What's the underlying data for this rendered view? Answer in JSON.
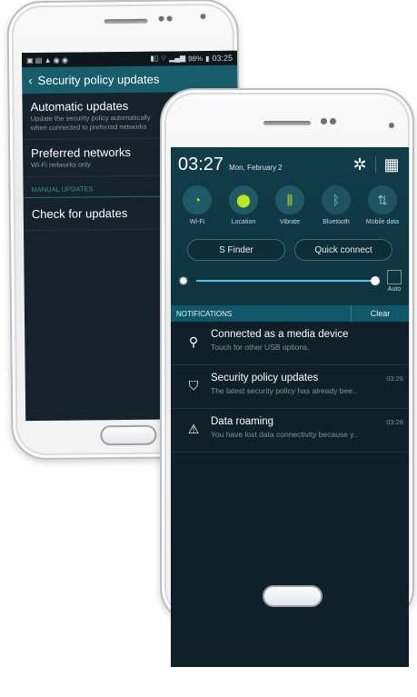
{
  "back_phone": {
    "status_bar": {
      "time": "03:25",
      "battery": "98%"
    },
    "action_bar": {
      "title": "Security policy updates"
    },
    "items": [
      {
        "title": "Automatic updates",
        "subtitle": "Update the security policy automatically",
        "subtitle2": "when connected to preferred networks"
      },
      {
        "title": "Preferred networks",
        "subtitle": "Wi-Fi networks only"
      }
    ],
    "section_header": "MANUAL UPDATES",
    "manual_item": {
      "title": "Check for updates"
    }
  },
  "front_phone": {
    "time": "03:27",
    "date": "Mon, February 2",
    "toggles": [
      {
        "label": "Wi-Fi",
        "icon": "wifi-icon",
        "on": true
      },
      {
        "label": "Location",
        "icon": "location-icon",
        "on": true
      },
      {
        "label": "Vibrate",
        "icon": "vibrate-icon",
        "on": true
      },
      {
        "label": "Bluetooth",
        "icon": "bluetooth-icon",
        "on": false
      },
      {
        "label": "Mobile data",
        "icon": "mobile-data-icon",
        "on": false
      }
    ],
    "buttons": {
      "s_finder": "S Finder",
      "quick_connect": "Quick connect"
    },
    "brightness": {
      "auto_label": "Auto",
      "level": 0.85
    },
    "notifications_header": "NOTIFICATIONS",
    "clear_label": "Clear",
    "notifications": [
      {
        "icon": "usb-icon",
        "title": "Connected as a media device",
        "text": "Touch for other USB options.",
        "time": ""
      },
      {
        "icon": "shield-icon",
        "title": "Security policy updates",
        "text": "The latest security policy has already bee..",
        "time": "03:26"
      },
      {
        "icon": "warning-icon",
        "title": "Data roaming",
        "text": "You have lost data connectivity because y..",
        "time": "03:26"
      }
    ]
  },
  "colors": {
    "accent_teal": "#175d6b",
    "toggle_on": "#b9e81e",
    "slider": "#56c3e6"
  }
}
